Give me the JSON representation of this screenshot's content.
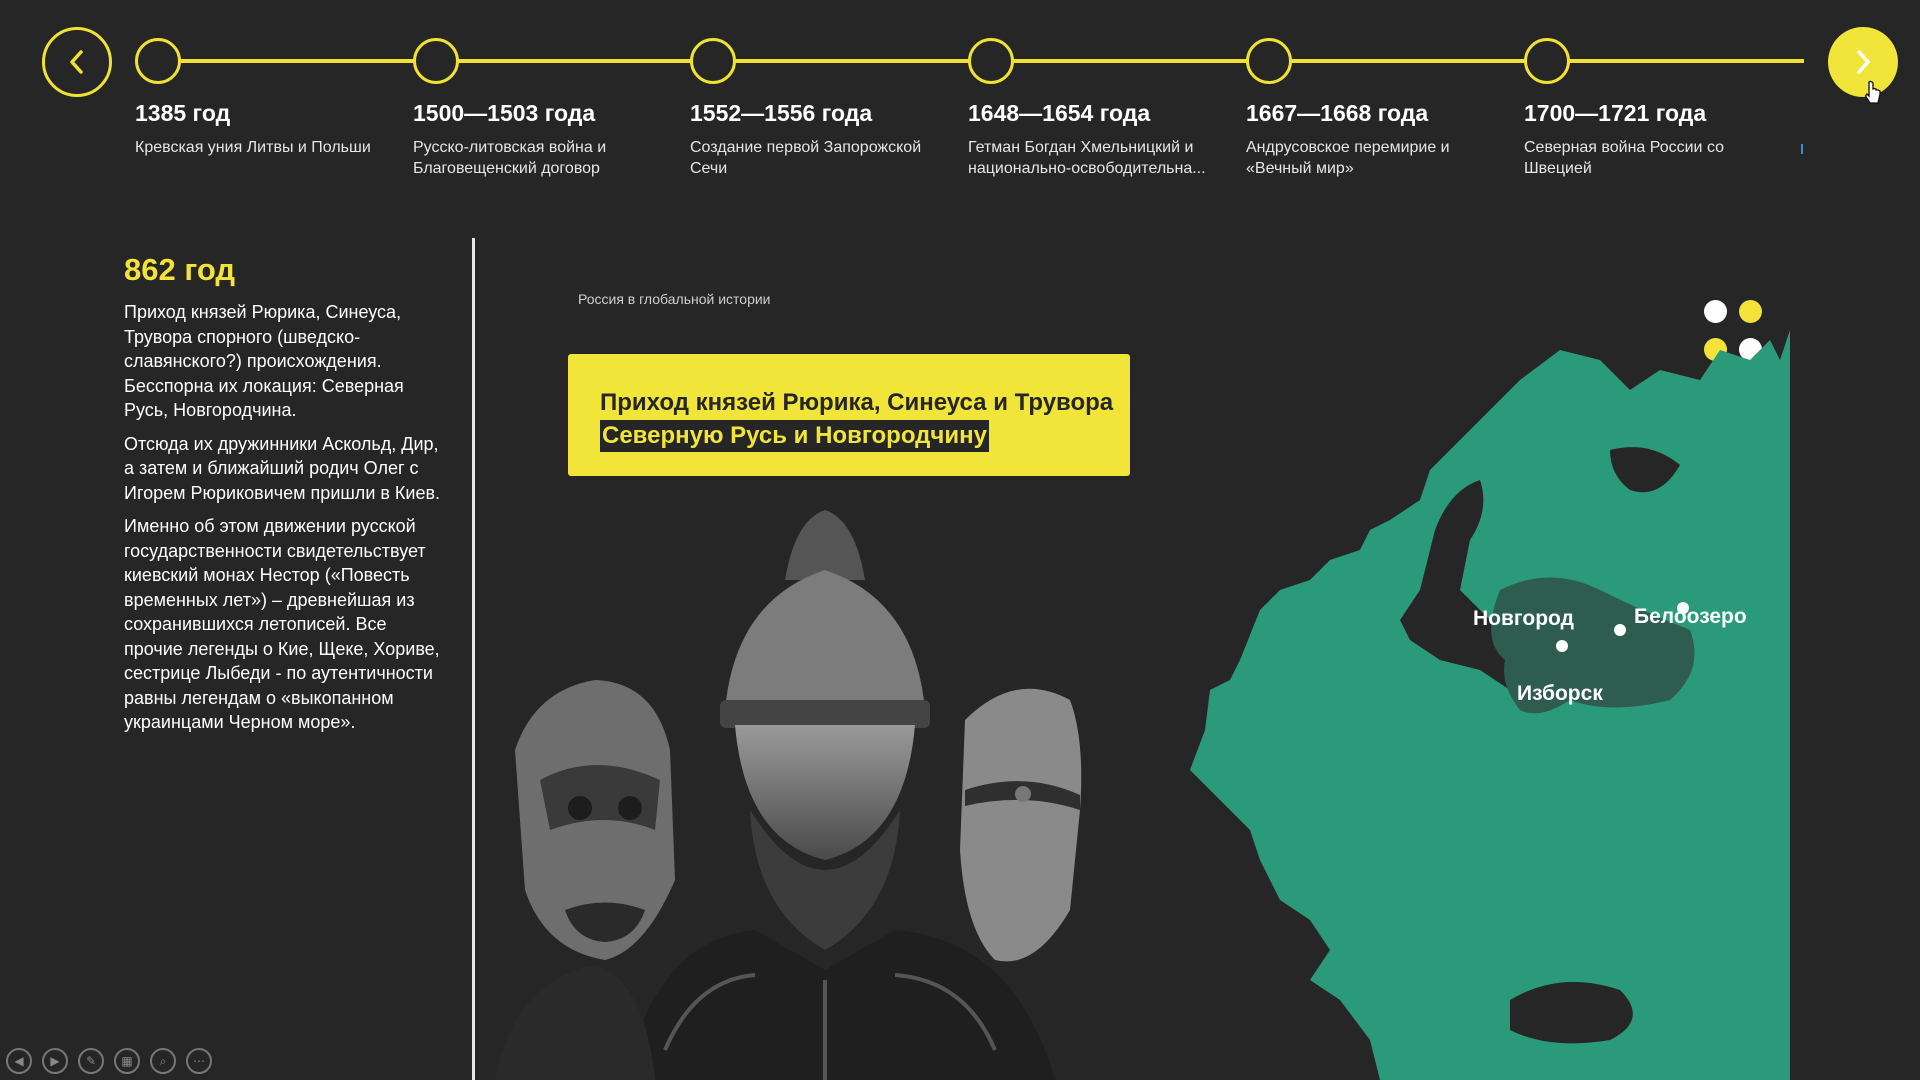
{
  "timeline": {
    "items": [
      {
        "year": "1385 год",
        "desc": "Кревская уния Литвы и Польши"
      },
      {
        "year": "1500—1503 года",
        "desc": "Русско-литовская война и Благовещенский договор"
      },
      {
        "year": "1552—1556 года",
        "desc": "Создание первой Запорожской Сечи"
      },
      {
        "year": "1648—1654 года",
        "desc": "Гетман Богдан Хмельницкий и национально-освободительна..."
      },
      {
        "year": "1667—1668 года",
        "desc": "Андрусовское перемирие и «Вечный мир»"
      },
      {
        "year": "1700—1721 года",
        "desc": "Северная война России со Швецией"
      }
    ]
  },
  "event": {
    "year": "862 год",
    "paragraphs": [
      "Приход князей Рюрика, Синеуса, Трувора спорного (шведско-славянского?) происхождения. Бесспорна их локация: Северная Русь, Новгородчина.",
      "Отсюда их дружинники Аскольд, Дир, а затем и ближайший родич Олег с Игорем Рюриковичем пришли в Киев.",
      "Именно об этом движении русской государственности свидетельствует киевский монах Нестор («Повесть временных лет») – древнейшая из сохранившихся летописей. Все прочие легенды о Кие, Щеке, Хориве, сестрице Лыбеди - по аутентичности равны легендам о «выкопанном украинцами Черном море»."
    ]
  },
  "slide": {
    "caption": "Россия в глобальной истории",
    "headline_line1": "Приход князей Рюрика, Синеуса и Трувора",
    "headline_line2": "Северную Русь и Новгородчину"
  },
  "map": {
    "cities": {
      "novgorod": "Новгород",
      "beloozero": "Белоозеро",
      "izborsk": "Изборск"
    }
  },
  "colors": {
    "accent": "#f2e53a",
    "background": "#262626",
    "map_land": "#2b9a7a",
    "map_region": "#2e5c4f"
  },
  "toolbar": {
    "icons": [
      "previous-icon",
      "next-icon",
      "pen-icon",
      "slides-grid-icon",
      "zoom-icon",
      "more-icon"
    ]
  }
}
